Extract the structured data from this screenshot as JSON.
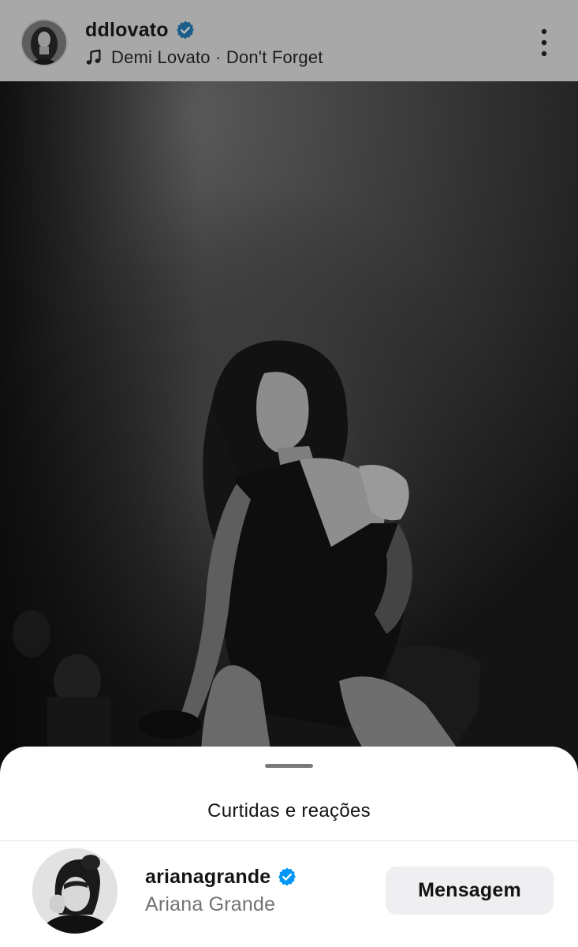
{
  "post": {
    "username": "ddlovato",
    "verified": true,
    "music_label": "Demi Lovato · Don't Forget",
    "more_icon": "more-vertical-icon",
    "music_icon": "music-note-icon"
  },
  "sheet": {
    "title": "Curtidas e reações"
  },
  "likes": [
    {
      "username": "arianagrande",
      "full_name": "Ariana Grande",
      "verified": true,
      "action_label": "Mensagem"
    }
  ],
  "colors": {
    "verified_badge": "#0095f6",
    "dim_overlay": "#a8a8a8",
    "sheet_background": "#ffffff",
    "button_background": "#efeff1",
    "secondary_text": "#737373"
  }
}
